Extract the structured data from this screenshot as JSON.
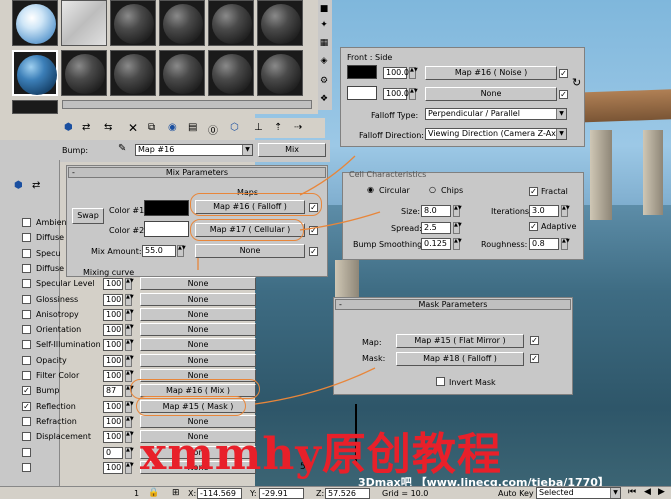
{
  "material_editor": {
    "bump_label": "Bump:",
    "bump_map": "Map #16",
    "map_type_button": "Mix"
  },
  "mix_params": {
    "header": "Mix Parameters",
    "maps_label": "Maps",
    "swap_label": "Swap",
    "color1_label": "Color #1",
    "color1_map": "Map #16  ( Falloff )",
    "color2_label": "Color #2",
    "color2_map": "Map #17  ( Cellular )",
    "mix_amount_label": "Mix Amount:",
    "mix_amount": "55.0",
    "mix_map": "None",
    "mixing_curve": "Mixing curve"
  },
  "maps_list": [
    {
      "label": "Ambient",
      "enabled": false,
      "amount": "",
      "map": ""
    },
    {
      "label": "Diffuse",
      "enabled": false,
      "amount": "",
      "map": ""
    },
    {
      "label": "Specu",
      "enabled": false,
      "amount": "",
      "map": ""
    },
    {
      "label": "Diffuse",
      "enabled": false,
      "amount": "",
      "map": ""
    },
    {
      "label": "Specular Level",
      "enabled": false,
      "amount": "100",
      "map": "None"
    },
    {
      "label": "Glossiness",
      "enabled": false,
      "amount": "100",
      "map": "None"
    },
    {
      "label": "Anisotropy",
      "enabled": false,
      "amount": "100",
      "map": "None"
    },
    {
      "label": "Orientation",
      "enabled": false,
      "amount": "100",
      "map": "None"
    },
    {
      "label": "Self-Illumination",
      "enabled": false,
      "amount": "100",
      "map": "None"
    },
    {
      "label": "Opacity",
      "enabled": false,
      "amount": "100",
      "map": "None"
    },
    {
      "label": "Filter Color",
      "enabled": false,
      "amount": "100",
      "map": "None"
    },
    {
      "label": "Bump",
      "enabled": true,
      "amount": "87",
      "map": "Map #16  ( Mix )"
    },
    {
      "label": "Reflection",
      "enabled": true,
      "amount": "100",
      "map": "Map #15  ( Mask )"
    },
    {
      "label": "Refraction",
      "enabled": false,
      "amount": "100",
      "map": "None"
    },
    {
      "label": "Displacement",
      "enabled": false,
      "amount": "100",
      "map": "None"
    },
    {
      "label": "",
      "enabled": false,
      "amount": "0",
      "map": "None"
    },
    {
      "label": "",
      "enabled": false,
      "amount": "100",
      "map": "None"
    }
  ],
  "falloff": {
    "header": "Front : Side",
    "val1": "100.0",
    "map1": "Map #16  ( Noise )",
    "val2": "100.0",
    "map2": "None",
    "type_label": "Falloff Type:",
    "type_value": "Perpendicular / Parallel",
    "direction_label": "Falloff Direction:",
    "direction_value": "Viewing Direction (Camera Z-Axis)"
  },
  "cellular": {
    "header": "Cell Characteristics",
    "circular": "Circular",
    "chips": "Chips",
    "fractal": "Fractal",
    "size_label": "Size:",
    "size": "8.0",
    "iterations_label": "Iterations:",
    "iterations": "3.0",
    "spread_label": "Spread:",
    "spread": "2.5",
    "adaptive": "Adaptive",
    "bump_smoothing_label": "Bump Smoothing:",
    "bump_smoothing": "0.125",
    "roughness_label": "Roughness:",
    "roughness": "0.8"
  },
  "mask": {
    "header": "Mask Parameters",
    "map_label": "Map:",
    "map_value": "Map #15  ( Flat Mirror )",
    "mask_label": "Mask:",
    "mask_value": "Map #18  ( Falloff )",
    "invert": "Invert Mask"
  },
  "viewport": {
    "ruler_mark": "50"
  },
  "status": {
    "frame": "1",
    "x_label": "X:",
    "x": "-114.569",
    "y_label": "Y:",
    "y": "-29.91",
    "z_label": "Z:",
    "z": "57.526",
    "grid": "Grid = 10.0",
    "autokey": "Auto Key",
    "selected": "Selected"
  },
  "watermark": {
    "text": "xmmhy原创教程",
    "url": "3Dmax吧 【www.linecg.com/tieba/1770】"
  }
}
